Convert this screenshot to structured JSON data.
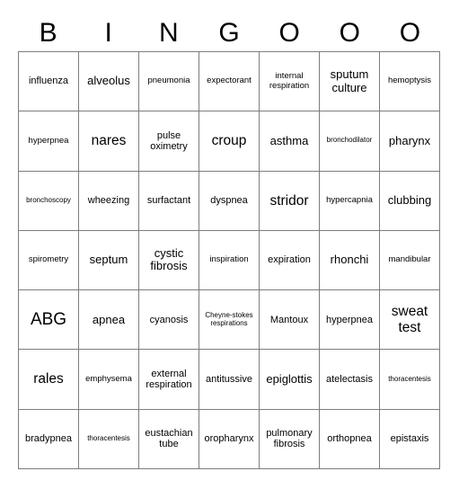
{
  "card": {
    "title": "Bingo Card",
    "columns": 7,
    "rows": 7,
    "grid_line_color": "#7d7d7d",
    "background_color": "#ffffff",
    "text_color": "#000000"
  },
  "header": {
    "letters": [
      "B",
      "I",
      "N",
      "G",
      "O",
      "O",
      "O"
    ]
  },
  "cells": [
    {
      "text": "influenza",
      "size": "m"
    },
    {
      "text": "alveolus",
      "size": "l"
    },
    {
      "text": "pneumonia",
      "size": "s"
    },
    {
      "text": "expectorant",
      "size": "s"
    },
    {
      "text": "internal respiration",
      "size": "s"
    },
    {
      "text": "sputum culture",
      "size": "l"
    },
    {
      "text": "hemoptysis",
      "size": "s"
    },
    {
      "text": "hyperpnea",
      "size": "s"
    },
    {
      "text": "nares",
      "size": "xl"
    },
    {
      "text": "pulse oximetry",
      "size": "m"
    },
    {
      "text": "croup",
      "size": "xl"
    },
    {
      "text": "asthma",
      "size": "l"
    },
    {
      "text": "bronchodilator",
      "size": "xs"
    },
    {
      "text": "pharynx",
      "size": "l"
    },
    {
      "text": "bronchoscopy",
      "size": "xs"
    },
    {
      "text": "wheezing",
      "size": "m"
    },
    {
      "text": "surfactant",
      "size": "m"
    },
    {
      "text": "dyspnea",
      "size": "m"
    },
    {
      "text": "stridor",
      "size": "xl"
    },
    {
      "text": "hypercapnia",
      "size": "s"
    },
    {
      "text": "clubbing",
      "size": "l"
    },
    {
      "text": "spirometry",
      "size": "s"
    },
    {
      "text": "septum",
      "size": "l"
    },
    {
      "text": "cystic fibrosis",
      "size": "l"
    },
    {
      "text": "inspiration",
      "size": "s"
    },
    {
      "text": "expiration",
      "size": "m"
    },
    {
      "text": "rhonchi",
      "size": "l"
    },
    {
      "text": "mandibular",
      "size": "s"
    },
    {
      "text": "ABG",
      "size": "xxl"
    },
    {
      "text": "apnea",
      "size": "l"
    },
    {
      "text": "cyanosis",
      "size": "m"
    },
    {
      "text": "Cheyne-stokes respirations",
      "size": "xs"
    },
    {
      "text": "Mantoux",
      "size": "m"
    },
    {
      "text": "hyperpnea",
      "size": "m"
    },
    {
      "text": "sweat test",
      "size": "xl"
    },
    {
      "text": "rales",
      "size": "xl"
    },
    {
      "text": "emphysema",
      "size": "s"
    },
    {
      "text": "external respiration",
      "size": "m"
    },
    {
      "text": "antitussive",
      "size": "m"
    },
    {
      "text": "epiglottis",
      "size": "l"
    },
    {
      "text": "atelectasis",
      "size": "m"
    },
    {
      "text": "thoracentesis",
      "size": "xs"
    },
    {
      "text": "bradypnea",
      "size": "m"
    },
    {
      "text": "thoracentesis",
      "size": "xs"
    },
    {
      "text": "eustachian tube",
      "size": "m"
    },
    {
      "text": "oropharynx",
      "size": "m"
    },
    {
      "text": "pulmonary fibrosis",
      "size": "m"
    },
    {
      "text": "orthopnea",
      "size": "m"
    },
    {
      "text": "epistaxis",
      "size": "m"
    }
  ]
}
